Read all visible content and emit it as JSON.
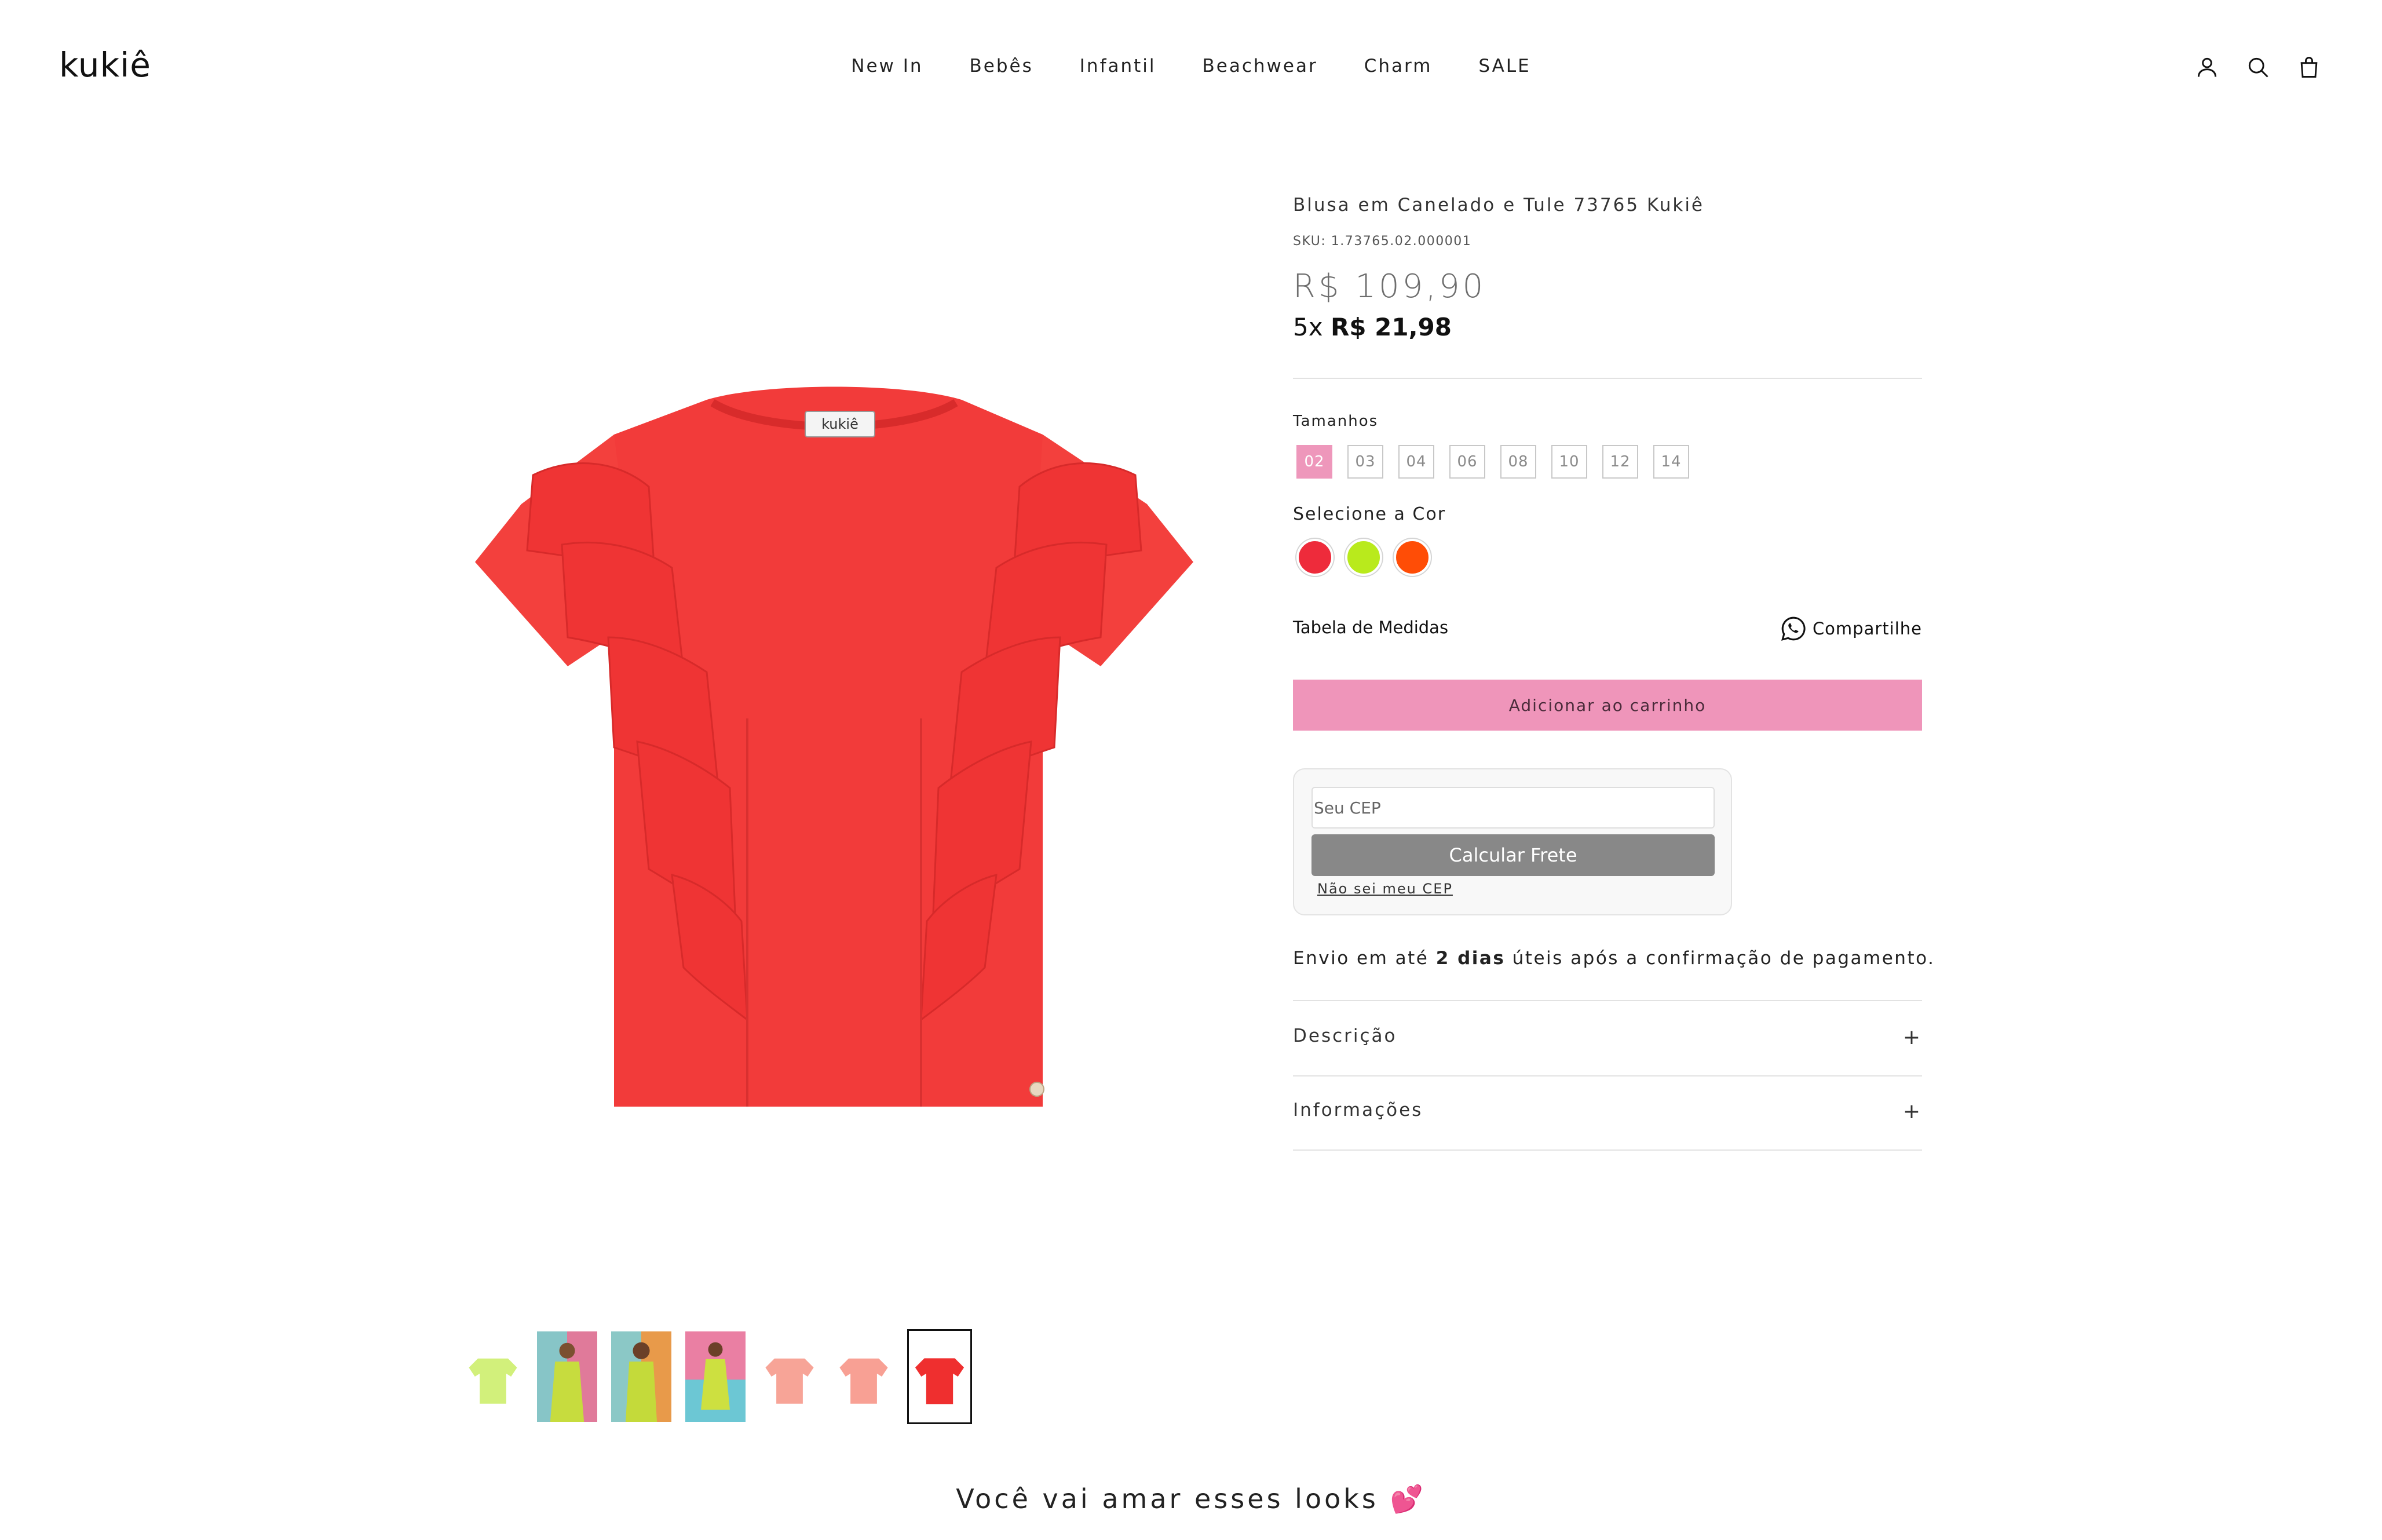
{
  "header": {
    "logo": "kukiê",
    "nav": [
      "New In",
      "Bebês",
      "Infantil",
      "Beachwear",
      "Charm",
      "SALE"
    ],
    "icons": [
      "account-icon",
      "search-icon",
      "bag-icon"
    ]
  },
  "product": {
    "title": "Blusa em Canelado e Tule 73765 Kukiê",
    "sku": "SKU: 1.73765.02.000001",
    "price": "R$ 109,90",
    "installments_prefix": "5x",
    "installments_value": "R$ 21,98",
    "label_tag": "kukiê"
  },
  "sizes": {
    "label": "Tamanhos",
    "options": [
      "02",
      "03",
      "04",
      "06",
      "08",
      "10",
      "12",
      "14"
    ],
    "selected": "02"
  },
  "colors": {
    "label": "Selecione a Cor",
    "options": [
      "#ee2b3b",
      "#b9ea1c",
      "#ff4d06"
    ]
  },
  "actions": {
    "measures": "Tabela de Medidas",
    "share": "Compartilhe",
    "add_to_cart": "Adicionar ao carrinho"
  },
  "shipping": {
    "placeholder": "Seu CEP",
    "calc_button": "Calcular Frete",
    "unknown_cep": "Não sei meu CEP",
    "info_prefix": "Envio em até",
    "info_days": "2 dias",
    "info_suffix": "úteis após a confirmação de pagamento."
  },
  "accordion": {
    "description": "Descrição",
    "information": "Informações",
    "toggle": "+"
  },
  "recommendations": {
    "title": "Você vai amar esses looks 💕"
  },
  "colors_theme": {
    "accent_pink": "#ef95ba",
    "shirt_red": "#f03a3a"
  }
}
